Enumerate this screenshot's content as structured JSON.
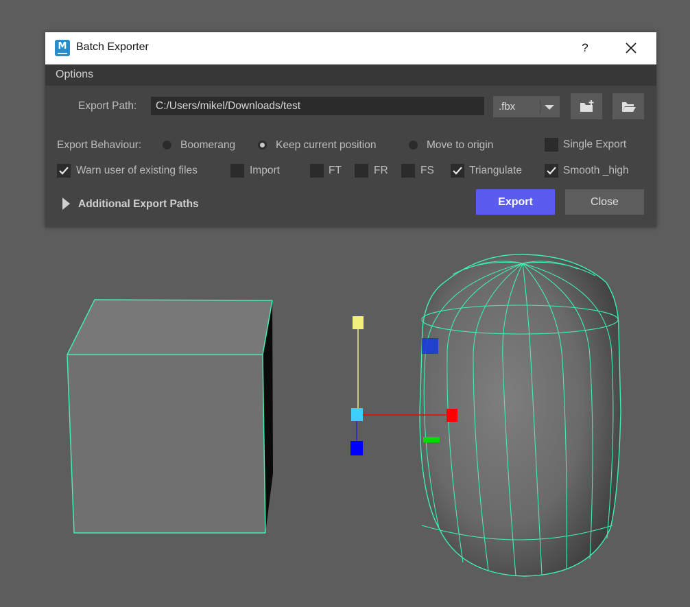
{
  "window": {
    "title": "Batch Exporter",
    "help_label": "?",
    "app_icon_letter": "M"
  },
  "menu": {
    "items": [
      "Options"
    ]
  },
  "export_path": {
    "label": "Export Path:",
    "value": "C:/Users/mikel/Downloads/test"
  },
  "format": {
    "selected": ".fbx"
  },
  "export_behaviour": {
    "label": "Export Behaviour:",
    "options": [
      {
        "label": "Boomerang",
        "selected": false
      },
      {
        "label": "Keep current position",
        "selected": true
      },
      {
        "label": "Move to origin",
        "selected": false
      }
    ]
  },
  "checkboxes": {
    "single_export": {
      "label": "Single Export",
      "checked": false
    },
    "warn": {
      "label": "Warn user of existing files",
      "checked": true
    },
    "import": {
      "label": "Import",
      "checked": false
    },
    "ft": {
      "label": "FT",
      "checked": false
    },
    "fr": {
      "label": "FR",
      "checked": false
    },
    "fs": {
      "label": "FS",
      "checked": false
    },
    "triangulate": {
      "label": "Triangulate",
      "checked": true
    },
    "smooth_high": {
      "label": "Smooth _high",
      "checked": true
    }
  },
  "additional_paths_label": "Additional Export Paths",
  "buttons": {
    "export": "Export",
    "close": "Close"
  },
  "colors": {
    "accent": "#5a5cf0",
    "wireframe": "#3ff0b0",
    "viewport_bg": "#5d5d5d",
    "manip_y": "#f2f07a",
    "manip_x": "#ff0000",
    "manip_z": "#0000ff",
    "manip_center": "#3ccfff",
    "manip_green": "#00dd00"
  }
}
